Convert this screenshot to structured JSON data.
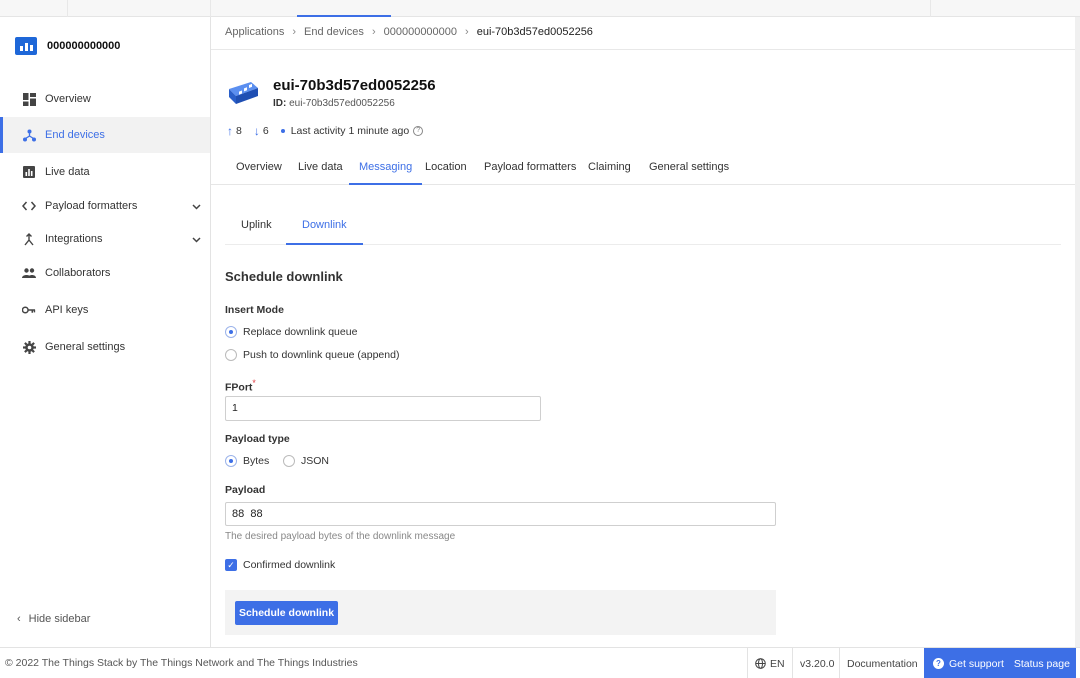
{
  "app": {
    "name": "000000000000"
  },
  "sidebar": {
    "items": [
      {
        "label": "Overview",
        "icon": "dashboard-icon"
      },
      {
        "label": "End devices",
        "icon": "devices-icon"
      },
      {
        "label": "Live data",
        "icon": "chart-icon"
      },
      {
        "label": "Payload formatters",
        "icon": "code-icon"
      },
      {
        "label": "Integrations",
        "icon": "integrations-icon"
      },
      {
        "label": "Collaborators",
        "icon": "people-icon"
      },
      {
        "label": "API keys",
        "icon": "key-icon"
      },
      {
        "label": "General settings",
        "icon": "gear-icon"
      }
    ],
    "active_item": "End devices",
    "hide_label": "Hide sidebar"
  },
  "breadcrumb": [
    "Applications",
    "End devices",
    "000000000000",
    "eui-70b3d57ed0052256"
  ],
  "device": {
    "title": "eui-70b3d57ed0052256",
    "id_label": "ID:",
    "id_value": "eui-70b3d57ed0052256",
    "uplink_count": "8",
    "downlink_count": "6",
    "last_activity": "Last activity 1 minute ago"
  },
  "tabs": [
    "Overview",
    "Live data",
    "Messaging",
    "Location",
    "Payload formatters",
    "Claiming",
    "General settings"
  ],
  "active_tab": "Messaging",
  "subtabs": [
    "Uplink",
    "Downlink"
  ],
  "active_subtab": "Downlink",
  "form": {
    "title": "Schedule downlink",
    "insert_mode_label": "Insert Mode",
    "insert_modes": [
      "Replace downlink queue",
      "Push to downlink queue (append)"
    ],
    "insert_mode_selected": "Replace downlink queue",
    "fport_label": "FPort",
    "fport_required": "*",
    "fport_value": "1",
    "payload_type_label": "Payload type",
    "payload_types": [
      "Bytes",
      "JSON"
    ],
    "payload_type_selected": "Bytes",
    "payload_label": "Payload",
    "payload_value": "88  88",
    "payload_hint": "The desired payload bytes of the downlink message",
    "confirmed_label": "Confirmed downlink",
    "confirmed_checked": true,
    "submit_label": "Schedule downlink"
  },
  "footer": {
    "copyright": "© 2022 The Things Stack by The Things Network and The Things Industries",
    "language": "EN",
    "version": "v3.20.0",
    "documentation": "Documentation",
    "support": "Get support",
    "status": "Status page"
  },
  "colors": {
    "accent": "#3d6fe6",
    "logo": "#1e67d8",
    "required": "#e0383e"
  }
}
